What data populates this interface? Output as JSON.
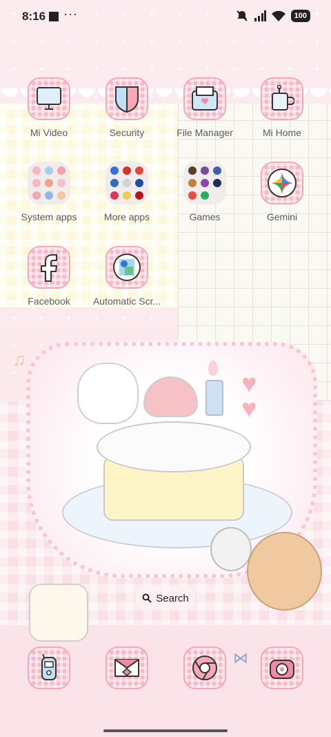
{
  "status_bar": {
    "time": "8:16",
    "overflow": "···",
    "battery": "100",
    "icons": [
      "notification-square-icon",
      "mute-icon",
      "signal-icon",
      "wifi-icon",
      "battery-icon"
    ]
  },
  "apps": [
    {
      "label": "Mi Video",
      "icon": "tv-icon"
    },
    {
      "label": "Security",
      "icon": "shield-icon"
    },
    {
      "label": "File Manager",
      "icon": "folder-heart-icon"
    },
    {
      "label": "Mi Home",
      "icon": "mug-icon"
    },
    {
      "label": "System apps",
      "icon": "folder-icon"
    },
    {
      "label": "More apps",
      "icon": "folder-icon"
    },
    {
      "label": "Games",
      "icon": "folder-icon"
    },
    {
      "label": "Gemini",
      "icon": "gemini-star-icon"
    },
    {
      "label": "Facebook",
      "icon": "facebook-icon"
    },
    {
      "label": "Automatic Scr...",
      "icon": "screenshot-icon"
    }
  ],
  "dock": [
    {
      "icon": "phone-icon"
    },
    {
      "icon": "envelope-icon"
    },
    {
      "icon": "chrome-icon"
    },
    {
      "icon": "camera-icon"
    }
  ],
  "search": {
    "label": "Search"
  },
  "colors": {
    "accent": "#f7b9c8",
    "frame": "#f3a7ba",
    "text": "#5a5a5a"
  }
}
